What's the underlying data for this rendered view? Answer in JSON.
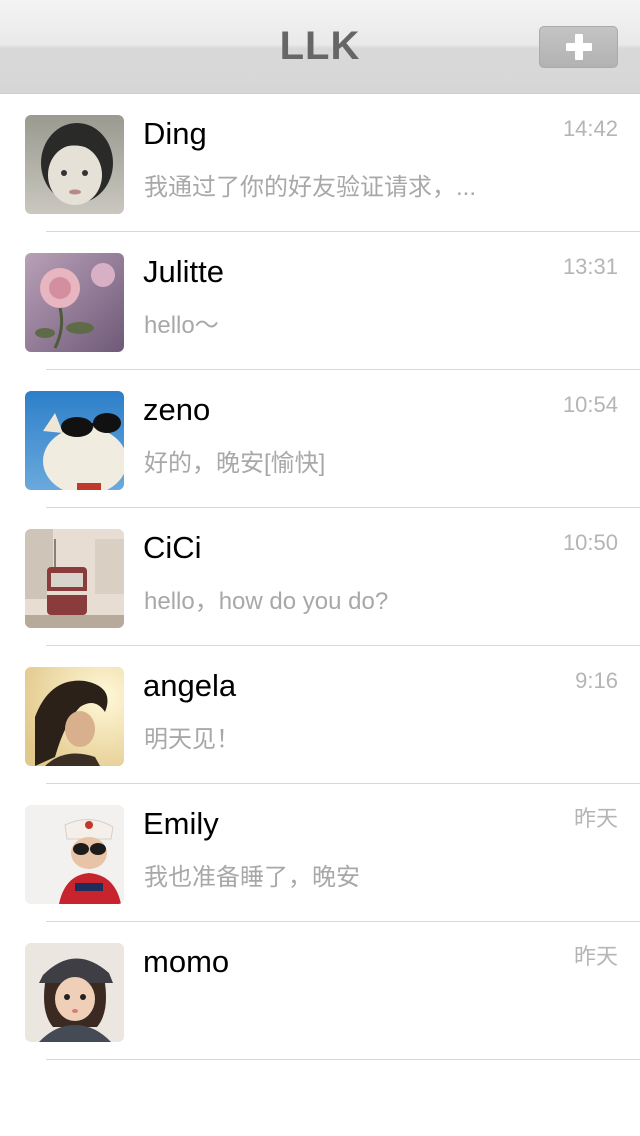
{
  "header": {
    "title": "LLK",
    "add_icon": "plus-icon"
  },
  "chats": [
    {
      "name": "Ding",
      "time": "14:42",
      "message": "我通过了你的好友验证请求，..."
    },
    {
      "name": "Julitte",
      "time": "13:31",
      "message": "hello～"
    },
    {
      "name": "zeno",
      "time": "10:54",
      "message": "好的，晚安[愉快]"
    },
    {
      "name": "CiCi",
      "time": "10:50",
      "message": "hello，how do you do?"
    },
    {
      "name": "angela",
      "time": "9:16",
      "message": "明天见！"
    },
    {
      "name": "Emily",
      "time": "昨天",
      "message": "我也准备睡了，晚安"
    },
    {
      "name": "momo",
      "time": "昨天",
      "message": ""
    }
  ],
  "colors": {
    "header_title": "#666666",
    "time_text": "#b5b5b5",
    "preview_text": "#a8a8a8",
    "divider": "#d8d8d8"
  }
}
